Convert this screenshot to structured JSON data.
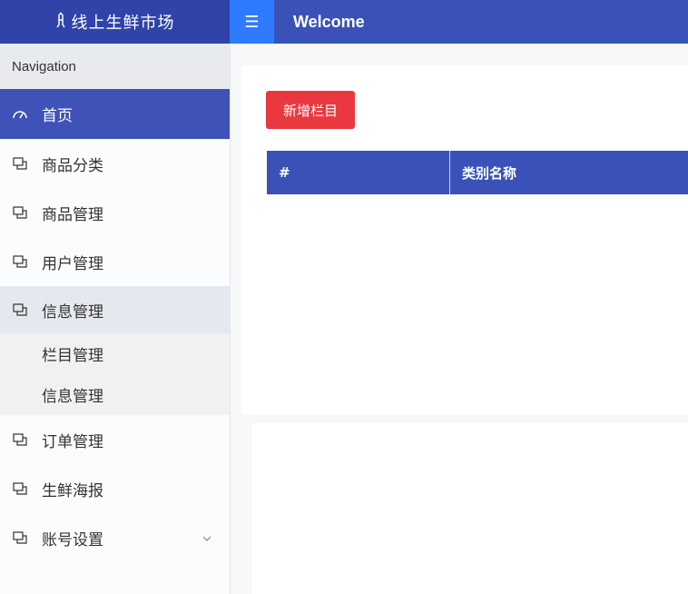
{
  "brand": {
    "icon": "tower-icon",
    "title": "线上生鲜市场"
  },
  "topbar": {
    "menu_icon": "hamburger-icon",
    "title": "Welcome"
  },
  "sidebar": {
    "header": "Navigation",
    "items": [
      {
        "label": "首页",
        "icon": "dashboard-icon",
        "state": "active"
      },
      {
        "label": "商品分类",
        "icon": "window-icon"
      },
      {
        "label": "商品管理",
        "icon": "window-icon"
      },
      {
        "label": "用户管理",
        "icon": "window-icon"
      },
      {
        "label": "信息管理",
        "icon": "window-icon",
        "state": "open",
        "children": [
          {
            "label": "栏目管理"
          },
          {
            "label": "信息管理"
          }
        ]
      },
      {
        "label": "订单管理",
        "icon": "window-icon"
      },
      {
        "label": "生鲜海报",
        "icon": "window-icon"
      },
      {
        "label": "账号设置",
        "icon": "window-icon",
        "caret": "chevron-down-icon"
      }
    ]
  },
  "main": {
    "add_button": "新增栏目",
    "table": {
      "columns": [
        "#",
        "类别名称"
      ],
      "rows": []
    }
  },
  "colors": {
    "brand": "#2f43a8",
    "topbar": "#3a52b8",
    "toggle": "#2e7bff",
    "active": "#3e52b8",
    "danger": "#e9393f"
  }
}
